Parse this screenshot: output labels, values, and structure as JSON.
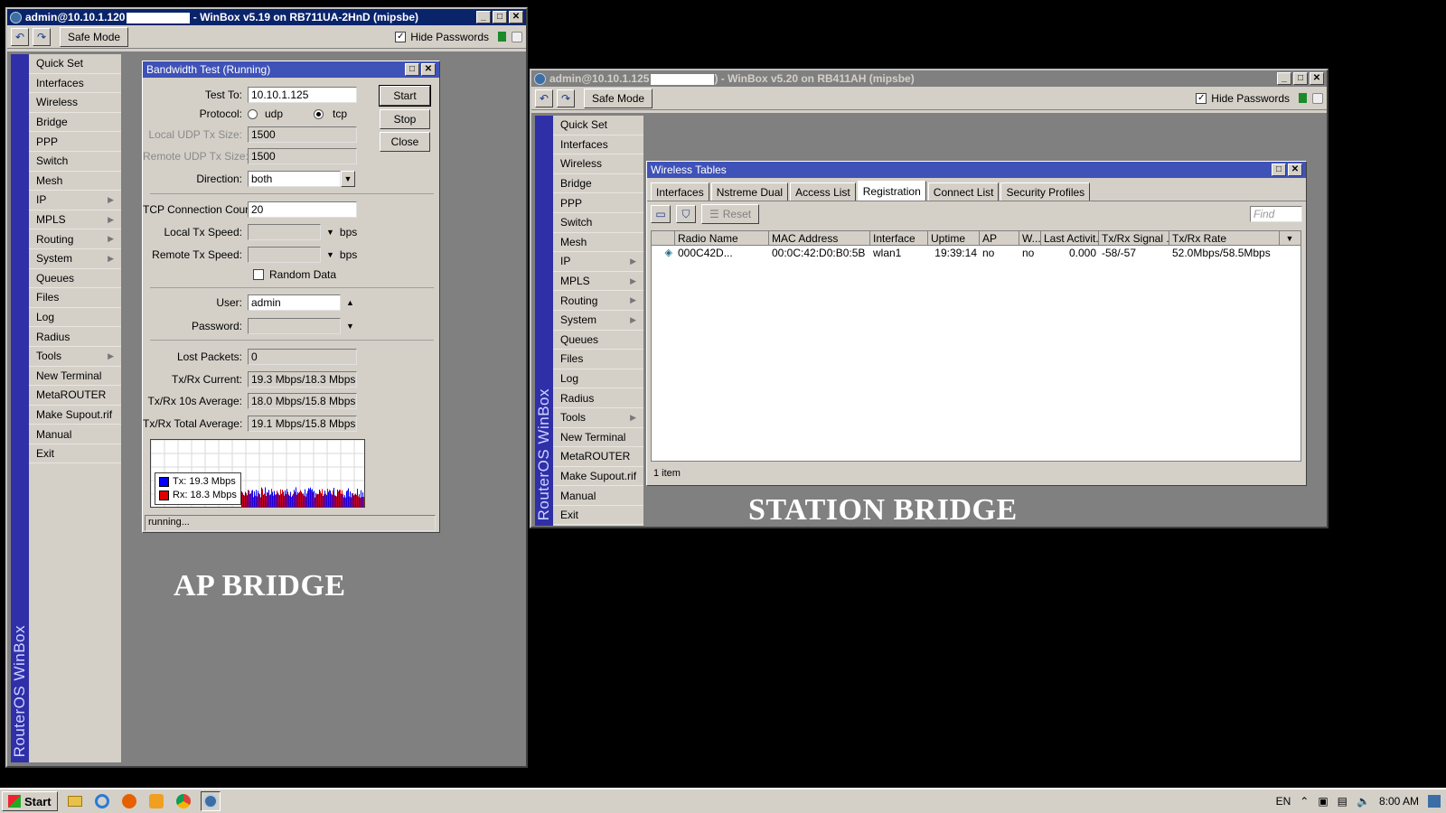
{
  "win1": {
    "title_prefix": "admin@10.10.1.120",
    "title_suffix": " - WinBox v5.19 on RB711UA-2HnD (mipsbe)",
    "safe_mode": "Safe Mode",
    "hide_passwords": "Hide Passwords",
    "vertical_brand": "RouterOS WinBox",
    "caption": "AP BRIDGE",
    "menu": [
      {
        "label": "Quick Set",
        "arrow": false
      },
      {
        "label": "Interfaces",
        "arrow": false
      },
      {
        "label": "Wireless",
        "arrow": false
      },
      {
        "label": "Bridge",
        "arrow": false
      },
      {
        "label": "PPP",
        "arrow": false
      },
      {
        "label": "Switch",
        "arrow": false
      },
      {
        "label": "Mesh",
        "arrow": false
      },
      {
        "label": "IP",
        "arrow": true
      },
      {
        "label": "MPLS",
        "arrow": true
      },
      {
        "label": "Routing",
        "arrow": true
      },
      {
        "label": "System",
        "arrow": true
      },
      {
        "label": "Queues",
        "arrow": false
      },
      {
        "label": "Files",
        "arrow": false
      },
      {
        "label": "Log",
        "arrow": false
      },
      {
        "label": "Radius",
        "arrow": false
      },
      {
        "label": "Tools",
        "arrow": true
      },
      {
        "label": "New Terminal",
        "arrow": false
      },
      {
        "label": "MetaROUTER",
        "arrow": false
      },
      {
        "label": "Make Supout.rif",
        "arrow": false
      },
      {
        "label": "Manual",
        "arrow": false
      },
      {
        "label": "Exit",
        "arrow": false
      }
    ]
  },
  "bwtest": {
    "title": "Bandwidth Test (Running)",
    "test_to_label": "Test To:",
    "test_to": "10.10.1.125",
    "protocol_label": "Protocol:",
    "udp": "udp",
    "tcp": "tcp",
    "local_udp_label": "Local UDP Tx Size:",
    "local_udp": "1500",
    "remote_udp_label": "Remote UDP Tx Size:",
    "remote_udp": "1500",
    "direction_label": "Direction:",
    "direction": "both",
    "tcp_count_label": "TCP Connection Count:",
    "tcp_count": "20",
    "local_tx_label": "Local Tx Speed:",
    "remote_tx_label": "Remote Tx Speed:",
    "bps": "bps",
    "random_data": "Random Data",
    "user_label": "User:",
    "user": "admin",
    "password_label": "Password:",
    "lost_label": "Lost Packets:",
    "lost": "0",
    "current_label": "Tx/Rx Current:",
    "current": "19.3 Mbps/18.3 Mbps",
    "avg10_label": "Tx/Rx 10s Average:",
    "avg10": "18.0 Mbps/15.8 Mbps",
    "total_label": "Tx/Rx Total Average:",
    "total": "19.1 Mbps/15.8 Mbps",
    "start": "Start",
    "stop": "Stop",
    "close": "Close",
    "legend_tx": "Tx:  19.3 Mbps",
    "legend_rx": "Rx:  18.3 Mbps",
    "status": "running...",
    "colors": {
      "tx": "#0000ff",
      "rx": "#e00000"
    }
  },
  "win2": {
    "title_prefix": "admin@10.10.1.125",
    "title_suffix": ") - WinBox v5.20 on RB411AH (mipsbe)",
    "safe_mode": "Safe Mode",
    "hide_passwords": "Hide Passwords",
    "vertical_brand": "RouterOS WinBox",
    "caption": "STATION BRIDGE",
    "menu": [
      {
        "label": "Quick Set",
        "arrow": false
      },
      {
        "label": "Interfaces",
        "arrow": false
      },
      {
        "label": "Wireless",
        "arrow": false
      },
      {
        "label": "Bridge",
        "arrow": false
      },
      {
        "label": "PPP",
        "arrow": false
      },
      {
        "label": "Switch",
        "arrow": false
      },
      {
        "label": "Mesh",
        "arrow": false
      },
      {
        "label": "IP",
        "arrow": true
      },
      {
        "label": "MPLS",
        "arrow": true
      },
      {
        "label": "Routing",
        "arrow": true
      },
      {
        "label": "System",
        "arrow": true
      },
      {
        "label": "Queues",
        "arrow": false
      },
      {
        "label": "Files",
        "arrow": false
      },
      {
        "label": "Log",
        "arrow": false
      },
      {
        "label": "Radius",
        "arrow": false
      },
      {
        "label": "Tools",
        "arrow": true
      },
      {
        "label": "New Terminal",
        "arrow": false
      },
      {
        "label": "MetaROUTER",
        "arrow": false
      },
      {
        "label": "Make Supout.rif",
        "arrow": false
      },
      {
        "label": "Manual",
        "arrow": false
      },
      {
        "label": "Exit",
        "arrow": false
      }
    ]
  },
  "wtables": {
    "title": "Wireless Tables",
    "tabs": [
      "Interfaces",
      "Nstreme Dual",
      "Access List",
      "Registration",
      "Connect List",
      "Security Profiles"
    ],
    "selected_tab": "Registration",
    "reset": "Reset",
    "find_placeholder": "Find",
    "columns": [
      "Radio Name",
      "MAC Address",
      "Interface",
      "Uptime",
      "AP",
      "W...",
      "Last Activit...",
      "Tx/Rx Signal ...",
      "Tx/Rx Rate"
    ],
    "rows": [
      [
        "000C42D...",
        "00:0C:42:D0:B0:5B",
        "wlan1",
        "19:39:14",
        "no",
        "no",
        "0.000",
        "-58/-57",
        "52.0Mbps/58.5Mbps"
      ]
    ],
    "footer": "1 item"
  },
  "taskbar": {
    "start": "Start",
    "lang": "EN",
    "time": "8:00 AM"
  }
}
